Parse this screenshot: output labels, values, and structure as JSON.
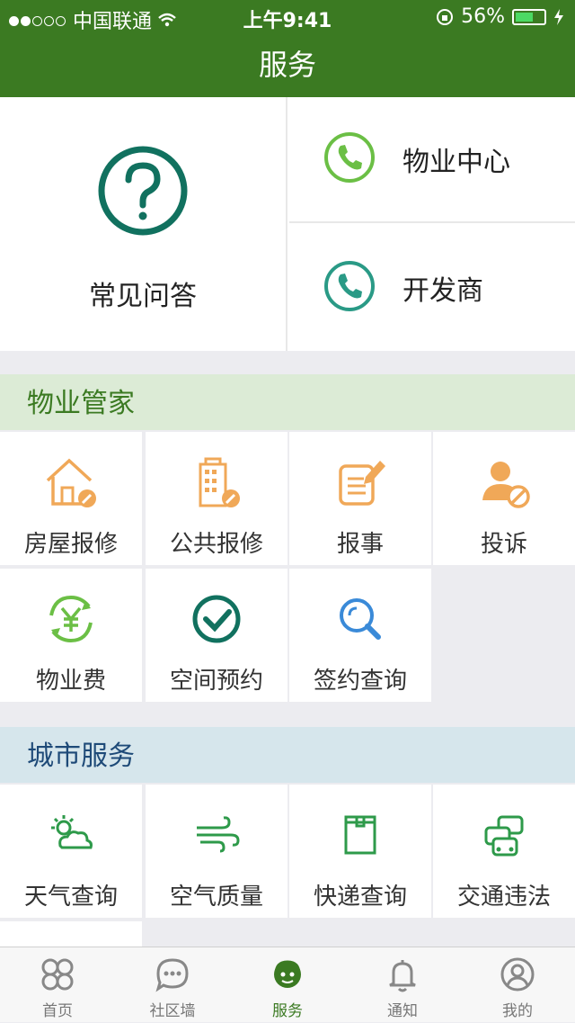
{
  "status_bar": {
    "carrier": "中国联通",
    "time": "上午9:41",
    "battery": "56%"
  },
  "nav": {
    "title": "服务"
  },
  "top": {
    "faq_label": "常见问答",
    "contacts": [
      {
        "label": "物业中心"
      },
      {
        "label": "开发商"
      }
    ]
  },
  "property": {
    "header": "物业管家",
    "items": [
      {
        "label": "房屋报修",
        "icon": "house-repair-icon"
      },
      {
        "label": "公共报修",
        "icon": "building-repair-icon"
      },
      {
        "label": "报事",
        "icon": "report-icon"
      },
      {
        "label": "投诉",
        "icon": "complaint-icon"
      },
      {
        "label": "物业费",
        "icon": "yen-icon"
      },
      {
        "label": "空间预约",
        "icon": "check-icon"
      },
      {
        "label": "签约查询",
        "icon": "search-icon"
      }
    ]
  },
  "city": {
    "header": "城市服务",
    "items": [
      {
        "label": "天气查询",
        "icon": "weather-icon"
      },
      {
        "label": "空气质量",
        "icon": "wind-icon"
      },
      {
        "label": "快递查询",
        "icon": "box-icon"
      },
      {
        "label": "交通违法",
        "icon": "cars-icon"
      }
    ]
  },
  "tabbar": {
    "items": [
      {
        "label": "首页"
      },
      {
        "label": "社区墙"
      },
      {
        "label": "服务"
      },
      {
        "label": "通知"
      },
      {
        "label": "我的"
      }
    ],
    "active": 2
  },
  "colors": {
    "brand": "#3b7a22",
    "section_green_bg": "#dcebd6",
    "section_blue_bg": "#d6e6ec",
    "orange": "#f0a858"
  }
}
